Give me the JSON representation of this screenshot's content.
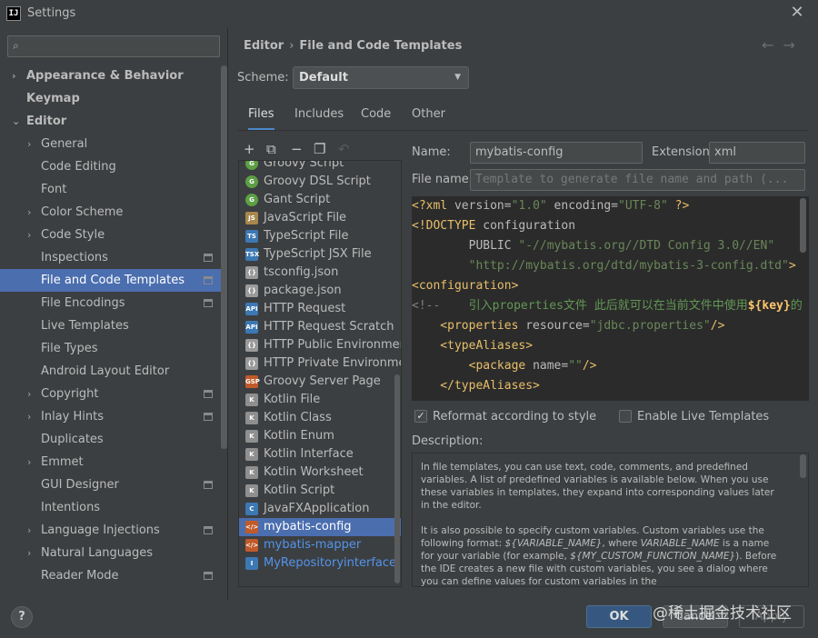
{
  "window": {
    "title": "Settings",
    "app_icon_text": "IJ"
  },
  "sidebar": {
    "search_placeholder": "",
    "items": [
      {
        "label": "Appearance & Behavior",
        "level": 0,
        "arrow": "›",
        "bold": true,
        "badge": false
      },
      {
        "label": "Keymap",
        "level": 0,
        "arrow": "",
        "bold": true,
        "badge": false
      },
      {
        "label": "Editor",
        "level": 0,
        "arrow": "⌄",
        "bold": true,
        "badge": false
      },
      {
        "label": "General",
        "level": 1,
        "arrow": "›",
        "bold": false,
        "badge": false
      },
      {
        "label": "Code Editing",
        "level": 1,
        "arrow": "",
        "bold": false,
        "badge": false
      },
      {
        "label": "Font",
        "level": 1,
        "arrow": "",
        "bold": false,
        "badge": false
      },
      {
        "label": "Color Scheme",
        "level": 1,
        "arrow": "›",
        "bold": false,
        "badge": false
      },
      {
        "label": "Code Style",
        "level": 1,
        "arrow": "›",
        "bold": false,
        "badge": false
      },
      {
        "label": "Inspections",
        "level": 1,
        "arrow": "",
        "bold": false,
        "badge": true
      },
      {
        "label": "File and Code Templates",
        "level": 1,
        "arrow": "",
        "bold": false,
        "badge": true,
        "selected": true
      },
      {
        "label": "File Encodings",
        "level": 1,
        "arrow": "",
        "bold": false,
        "badge": true
      },
      {
        "label": "Live Templates",
        "level": 1,
        "arrow": "",
        "bold": false,
        "badge": false
      },
      {
        "label": "File Types",
        "level": 1,
        "arrow": "",
        "bold": false,
        "badge": false
      },
      {
        "label": "Android Layout Editor",
        "level": 1,
        "arrow": "",
        "bold": false,
        "badge": false
      },
      {
        "label": "Copyright",
        "level": 1,
        "arrow": "›",
        "bold": false,
        "badge": true
      },
      {
        "label": "Inlay Hints",
        "level": 1,
        "arrow": "›",
        "bold": false,
        "badge": true
      },
      {
        "label": "Duplicates",
        "level": 1,
        "arrow": "",
        "bold": false,
        "badge": false
      },
      {
        "label": "Emmet",
        "level": 1,
        "arrow": "›",
        "bold": false,
        "badge": false
      },
      {
        "label": "GUI Designer",
        "level": 1,
        "arrow": "",
        "bold": false,
        "badge": true
      },
      {
        "label": "Intentions",
        "level": 1,
        "arrow": "",
        "bold": false,
        "badge": false
      },
      {
        "label": "Language Injections",
        "level": 1,
        "arrow": "›",
        "bold": false,
        "badge": true
      },
      {
        "label": "Natural Languages",
        "level": 1,
        "arrow": "›",
        "bold": false,
        "badge": false
      },
      {
        "label": "Reader Mode",
        "level": 1,
        "arrow": "",
        "bold": false,
        "badge": true
      }
    ]
  },
  "header": {
    "breadcrumb": [
      "Editor",
      "File and Code Templates"
    ],
    "nav_back": "←",
    "nav_forward": "→",
    "scheme_label": "Scheme:",
    "scheme_value": "Default"
  },
  "tabs": [
    "Files",
    "Includes",
    "Code",
    "Other"
  ],
  "list_toolbar": [
    "+",
    "⧉",
    "−",
    "❐",
    "↶"
  ],
  "templates": [
    {
      "label": "Groovy Script",
      "icon": "groovy-icon",
      "color": "#5c9f45",
      "glyph": "G",
      "round": true
    },
    {
      "label": "Groovy DSL Script",
      "icon": "groovy-icon",
      "color": "#5c9f45",
      "glyph": "G",
      "round": true
    },
    {
      "label": "Gant Script",
      "icon": "groovy-icon",
      "color": "#5c9f45",
      "glyph": "G",
      "round": true
    },
    {
      "label": "JavaScript File",
      "icon": "javascript-file-icon",
      "color": "#a8874c",
      "glyph": "JS",
      "round": false
    },
    {
      "label": "TypeScript File",
      "icon": "typescript-file-icon",
      "color": "#3c78b4",
      "glyph": "TS",
      "round": false
    },
    {
      "label": "TypeScript JSX File",
      "icon": "tsx-file-icon",
      "color": "#3c78b4",
      "glyph": "TSX",
      "round": false
    },
    {
      "label": "tsconfig.json",
      "icon": "json-file-icon",
      "color": "#9a9a9a",
      "glyph": "{}",
      "round": false
    },
    {
      "label": "package.json",
      "icon": "json-file-icon",
      "color": "#9a9a9a",
      "glyph": "{}",
      "round": false
    },
    {
      "label": "HTTP Request",
      "icon": "http-file-icon",
      "color": "#3c78b4",
      "glyph": "API",
      "round": false
    },
    {
      "label": "HTTP Request Scratch",
      "icon": "http-file-icon",
      "color": "#3c78b4",
      "glyph": "API",
      "round": false
    },
    {
      "label": "HTTP Public Environment File",
      "icon": "http-env-icon",
      "color": "#9a9a9a",
      "glyph": "{}",
      "round": false
    },
    {
      "label": "HTTP Private Environment File",
      "icon": "http-env-icon",
      "color": "#9a9a9a",
      "glyph": "{}",
      "round": false
    },
    {
      "label": "Groovy Server Page",
      "icon": "gsp-file-icon",
      "color": "#c05a2a",
      "glyph": "GSP",
      "round": false
    },
    {
      "label": "Kotlin File",
      "icon": "kotlin-file-icon",
      "color": "#8f8f8f",
      "glyph": "K",
      "round": false
    },
    {
      "label": "Kotlin Class",
      "icon": "kotlin-class-icon",
      "color": "#8f8f8f",
      "glyph": "K",
      "round": false
    },
    {
      "label": "Kotlin Enum",
      "icon": "kotlin-enum-icon",
      "color": "#8f8f8f",
      "glyph": "K",
      "round": false
    },
    {
      "label": "Kotlin Interface",
      "icon": "kotlin-interface-icon",
      "color": "#8f8f8f",
      "glyph": "K",
      "round": false
    },
    {
      "label": "Kotlin Worksheet",
      "icon": "kotlin-worksheet-icon",
      "color": "#8f8f8f",
      "glyph": "K",
      "round": false
    },
    {
      "label": "Kotlin Script",
      "icon": "kotlin-script-icon",
      "color": "#8f8f8f",
      "glyph": "K",
      "round": false
    },
    {
      "label": "JavaFXApplication",
      "icon": "java-class-icon",
      "color": "#3c78b4",
      "glyph": "C",
      "round": false
    },
    {
      "label": "mybatis-config",
      "icon": "xml-file-icon",
      "color": "#c05a2a",
      "glyph": "</>",
      "round": false,
      "selected": true
    },
    {
      "label": "mybatis-mapper",
      "icon": "xml-file-icon",
      "color": "#c05a2a",
      "glyph": "</>",
      "round": false,
      "blue": true
    },
    {
      "label": "MyRepositoryinterface",
      "icon": "java-interface-icon",
      "color": "#3c78b4",
      "glyph": "I",
      "round": false,
      "blue": true
    }
  ],
  "form": {
    "name_label": "Name:",
    "name_value": "mybatis-config",
    "extension_label": "Extension:",
    "extension_value": "xml",
    "file_name_label": "File name:",
    "file_name_placeholder": "Template to generate file name and path (..."
  },
  "code_lines": [
    [
      [
        "k",
        "<?xml "
      ],
      [
        "a",
        "version="
      ],
      [
        "s",
        "\"1.0\""
      ],
      [
        "a",
        " encoding="
      ],
      [
        "s",
        "\"UTF-8\""
      ],
      [
        "k",
        " ?>"
      ]
    ],
    [
      [
        "k",
        "<!DOCTYPE "
      ],
      [
        "sel",
        "configuration"
      ]
    ],
    [
      [
        "sel",
        "        PUBLIC "
      ],
      [
        "s",
        "\"-//mybatis.org//DTD Config 3.0//EN\""
      ]
    ],
    [
      [
        "s",
        "        \"http://mybatis.org/dtd/mybatis-3-config.dtd\""
      ],
      [
        "k",
        ">"
      ]
    ],
    [
      [
        "k",
        "<configuration>"
      ]
    ],
    [
      [
        "c",
        "<!--    "
      ],
      [
        "cm",
        "引入properties文件 此后就可以在当前文件中使用"
      ],
      [
        "kb",
        "${key}"
      ],
      [
        "cm",
        "的"
      ]
    ],
    [
      [
        "k",
        "    <properties "
      ],
      [
        "a",
        "resource="
      ],
      [
        "s",
        "\"jdbc.properties\""
      ],
      [
        "k",
        "/>"
      ]
    ],
    [
      [
        "k",
        "    <typeAliases>"
      ]
    ],
    [
      [
        "k",
        "        <package "
      ],
      [
        "a",
        "name="
      ],
      [
        "s",
        "\"\""
      ],
      [
        "k",
        "/>"
      ]
    ],
    [
      [
        "k",
        "    </typeAliases>"
      ]
    ]
  ],
  "options": {
    "reformat_label": "Reformat according to style",
    "reformat_checked": true,
    "live_templates_label": "Enable Live Templates",
    "live_templates_checked": false
  },
  "description": {
    "label": "Description:",
    "p1": "In file templates, you can use text, code, comments, and predefined variables. A list of predefined variables is available below. When you use these variables in templates, they expand into corresponding values later in the editor.",
    "p2_a": "It is also possible to specify custom variables. Custom variables use the following format: ",
    "p2_var1": "${VARIABLE_NAME}",
    "p2_b": ", where ",
    "p2_var2": "VARIABLE_NAME",
    "p2_c": " is a name for your variable (for example, ",
    "p2_var3": "${MY_CUSTOM_FUNCTION_NAME}",
    "p2_d": "). Before the IDE creates a new file with custom variables, you see a dialog where you can define values for custom variables in the"
  },
  "footer": {
    "help": "?",
    "ok": "OK",
    "cancel": "Cancel",
    "apply": "Apply",
    "watermark": "@稀土掘金技术社区"
  }
}
